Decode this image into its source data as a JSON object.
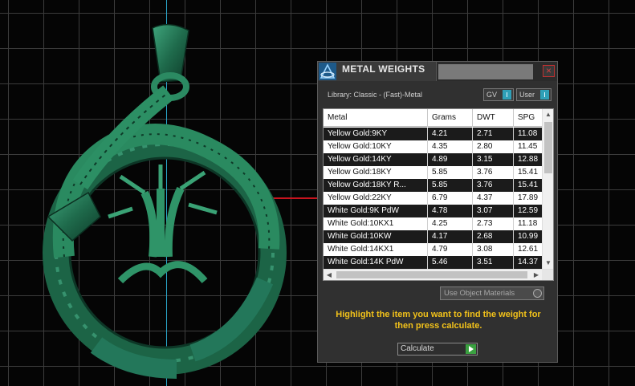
{
  "panel": {
    "title": "METAL WEIGHTS",
    "close_glyph": "×",
    "library_label": "Library: Classic - (Fast)-Metal",
    "toggle_gv": "GV",
    "toggle_user": "User",
    "columns": [
      "Metal",
      "Grams",
      "DWT",
      "SPG"
    ],
    "rows": [
      {
        "metal": "Yellow Gold:9KY",
        "grams": "4.21",
        "dwt": "2.71",
        "spg": "11.08"
      },
      {
        "metal": "Yellow Gold:10KY",
        "grams": "4.35",
        "dwt": "2.80",
        "spg": "11.45"
      },
      {
        "metal": "Yellow Gold:14KY",
        "grams": "4.89",
        "dwt": "3.15",
        "spg": "12.88"
      },
      {
        "metal": "Yellow Gold:18KY",
        "grams": "5.85",
        "dwt": "3.76",
        "spg": "15.41"
      },
      {
        "metal": "Yellow Gold:18KY R...",
        "grams": "5.85",
        "dwt": "3.76",
        "spg": "15.41"
      },
      {
        "metal": "Yellow Gold:22KY",
        "grams": "6.79",
        "dwt": "4.37",
        "spg": "17.89"
      },
      {
        "metal": "White Gold:9K PdW",
        "grams": "4.78",
        "dwt": "3.07",
        "spg": "12.59"
      },
      {
        "metal": "White Gold:10KX1",
        "grams": "4.25",
        "dwt": "2.73",
        "spg": "11.18"
      },
      {
        "metal": "White Gold:10KW",
        "grams": "4.17",
        "dwt": "2.68",
        "spg": "10.99"
      },
      {
        "metal": "White Gold:14KX1",
        "grams": "4.79",
        "dwt": "3.08",
        "spg": "12.61"
      },
      {
        "metal": "White Gold:14K PdW",
        "grams": "5.46",
        "dwt": "3.51",
        "spg": "14.37"
      }
    ],
    "use_materials_label": "Use Object Materials",
    "instructions": "Highlight the item you want to find the weight for then press calculate.",
    "calculate_label": "Calculate",
    "scroll_glyphs": {
      "up": "▲",
      "down": "▼",
      "left": "◀",
      "right": "▶"
    }
  },
  "colors": {
    "accent": "#2fa0b8",
    "instruction_text": "#f2c21a",
    "selected_row": "#1b1b1b",
    "model": "#1f6b4c"
  },
  "icons": [
    "app-logo-icon",
    "close-icon",
    "toggle-knob-icon",
    "radio-icon",
    "play-arrow-icon"
  ]
}
